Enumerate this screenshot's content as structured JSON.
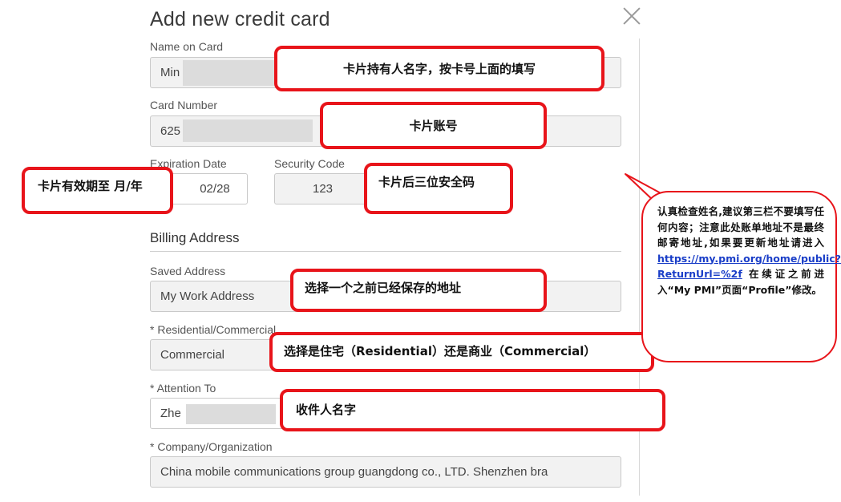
{
  "title": "Add new credit card",
  "card": {
    "name_label": "Name on Card",
    "name_value": "Min",
    "number_label": "Card Number",
    "number_value": "625",
    "expiry_label": "Expiration Date",
    "expiry_value": "02/28",
    "security_label": "Security Code",
    "security_value": "123"
  },
  "billing": {
    "heading": "Billing Address",
    "saved_label": "Saved Address",
    "saved_value": "My Work Address",
    "type_label": "* Residential/Commercial",
    "type_value": "Commercial",
    "attention_label": "* Attention To",
    "attention_value": "Zhe",
    "company_label": "* Company/Organization",
    "company_value": "China mobile communications group guangdong co., LTD. Shenzhen bra"
  },
  "annotations": {
    "name": "卡片持有人名字，按卡号上面的填写",
    "number": "卡片账号",
    "expiry": "卡片有效期至 月/年",
    "security": "卡片后三位安全码",
    "saved": "选择一个之前已经保存的地址",
    "type": "选择是住宅（Residential）还是商业（Commercial）",
    "attention": "收件人名字",
    "bubble_text_1": "认真检查姓名,建议第三栏不要填写任何内容；注意此处账单地址不是最终邮寄地址,如果要更新地址请进入",
    "bubble_link": "https://my.pmi.org/home/public?ReturnUrl=%2f",
    "bubble_text_2": " 在续证之前进入“My PMI”页面“Profile”修改。"
  },
  "colors": {
    "callout_border": "#e8141a",
    "field_bg": "#f2f2f2",
    "link": "#1a3ec8"
  }
}
